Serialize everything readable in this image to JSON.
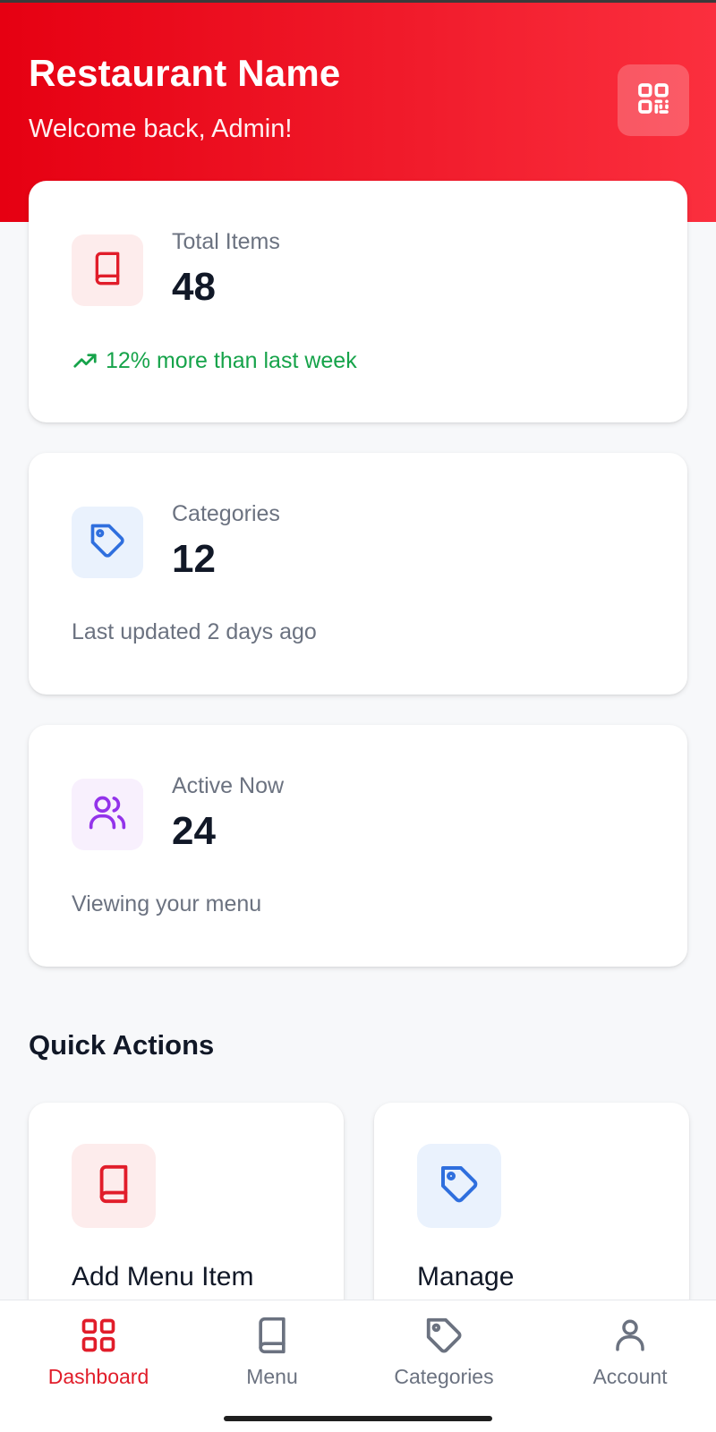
{
  "header": {
    "title": "Restaurant Name",
    "subtitle": "Welcome back, Admin!",
    "qr_icon": "qr-code-icon",
    "background": "#e60012"
  },
  "stats": [
    {
      "label": "Total Items",
      "value": "48",
      "footer": "12% more than last week",
      "footer_icon": "trending-up-icon",
      "icon": "book-icon",
      "icon_color": "#e11d2a",
      "icon_bg": "#fdecec"
    },
    {
      "label": "Categories",
      "value": "12",
      "footer": "Last updated 2 days ago",
      "icon": "tag-icon",
      "icon_color": "#2f6fde",
      "icon_bg": "#eaf2fd"
    },
    {
      "label": "Active Now",
      "value": "24",
      "footer": "Viewing your menu",
      "icon": "users-icon",
      "icon_color": "#9333ea",
      "icon_bg": "#f8f0fd"
    }
  ],
  "quick_actions": {
    "title": "Quick Actions",
    "items": [
      {
        "label": "Add Menu Item",
        "icon": "book-icon",
        "icon_color": "#e11d2a",
        "icon_bg": "#fdecec"
      },
      {
        "label": "Manage",
        "icon": "tag-icon",
        "icon_color": "#2f6fde",
        "icon_bg": "#eaf2fd"
      }
    ]
  },
  "bottom_nav": {
    "items": [
      {
        "label": "Dashboard",
        "icon": "dashboard-grid-icon",
        "active": true
      },
      {
        "label": "Menu",
        "icon": "book-icon",
        "active": false
      },
      {
        "label": "Categories",
        "icon": "tag-icon",
        "active": false
      },
      {
        "label": "Account",
        "icon": "user-icon",
        "active": false
      }
    ],
    "active_color": "#e11d2a",
    "inactive_color": "#6b7280"
  }
}
